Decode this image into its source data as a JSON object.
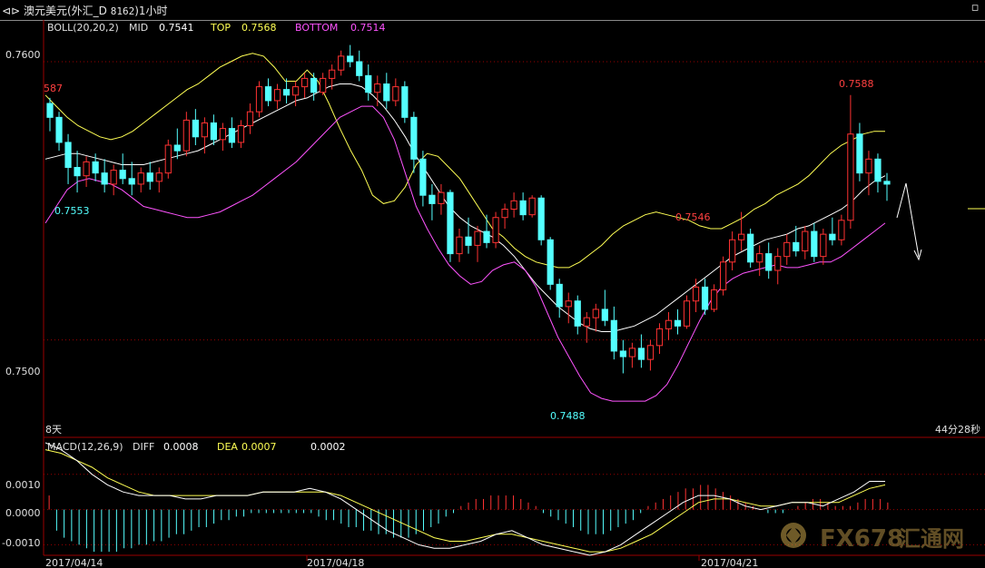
{
  "window": {
    "title": "澳元美元(外汇_D",
    "code": "8162",
    "period": ")1小时"
  },
  "colors": {
    "background": "#000000",
    "up": "#ff3232",
    "down": "#54ffff",
    "mid": "#ffffff",
    "top": "#ffff54",
    "bottom": "#ff54ff",
    "axis": "#9a0000",
    "text": "#e0e0e0"
  },
  "chart_data": [
    {
      "type": "candlestick",
      "indicator": {
        "name": "BOLL(20,20,2)",
        "mid_label": "MID",
        "mid_value": "0.7541",
        "top_label": "TOP",
        "top_value": "0.7568",
        "bottom_label": "BOTTOM",
        "bottom_value": "0.7514"
      },
      "y_ticks": [
        "0.7600",
        "0.7500"
      ],
      "ylim": [
        0.7465,
        0.7615
      ],
      "annotations": {
        "high_left": "587",
        "low_left": "0.7553",
        "high_mid": "0.7546",
        "low_mid": "0.7488",
        "high_right": "0.7588"
      },
      "footer_left": "8天",
      "footer_right": "44分28秒",
      "ohlc": [
        [
          0.7585,
          0.7587,
          0.7575,
          0.758
        ],
        [
          0.758,
          0.7582,
          0.7568,
          0.7571
        ],
        [
          0.7571,
          0.7574,
          0.7556,
          0.7562
        ],
        [
          0.7562,
          0.7568,
          0.7553,
          0.7559
        ],
        [
          0.7559,
          0.7566,
          0.7555,
          0.7564
        ],
        [
          0.7564,
          0.7567,
          0.7557,
          0.756
        ],
        [
          0.756,
          0.7565,
          0.7553,
          0.7556
        ],
        [
          0.7556,
          0.7563,
          0.7552,
          0.7561
        ],
        [
          0.7561,
          0.7567,
          0.7556,
          0.7558
        ],
        [
          0.7558,
          0.7564,
          0.7552,
          0.7556
        ],
        [
          0.7556,
          0.7562,
          0.7553,
          0.756
        ],
        [
          0.756,
          0.7564,
          0.7554,
          0.7557
        ],
        [
          0.7557,
          0.7562,
          0.7553,
          0.756
        ],
        [
          0.756,
          0.7572,
          0.7558,
          0.757
        ],
        [
          0.757,
          0.7576,
          0.7565,
          0.7568
        ],
        [
          0.7568,
          0.7582,
          0.7566,
          0.7579
        ],
        [
          0.7579,
          0.7583,
          0.757,
          0.7573
        ],
        [
          0.7573,
          0.758,
          0.7567,
          0.7578
        ],
        [
          0.7578,
          0.7581,
          0.757,
          0.7572
        ],
        [
          0.7572,
          0.7578,
          0.7568,
          0.7576
        ],
        [
          0.7576,
          0.758,
          0.7569,
          0.7571
        ],
        [
          0.7571,
          0.7579,
          0.7569,
          0.7577
        ],
        [
          0.7577,
          0.7585,
          0.7574,
          0.7582
        ],
        [
          0.7582,
          0.7593,
          0.758,
          0.7591
        ],
        [
          0.7591,
          0.7594,
          0.7584,
          0.7586
        ],
        [
          0.7586,
          0.7592,
          0.7583,
          0.759
        ],
        [
          0.759,
          0.7594,
          0.7585,
          0.7588
        ],
        [
          0.7588,
          0.7593,
          0.7584,
          0.7591
        ],
        [
          0.7591,
          0.7596,
          0.7587,
          0.7594
        ],
        [
          0.7594,
          0.7596,
          0.7586,
          0.7589
        ],
        [
          0.7589,
          0.7596,
          0.7588,
          0.7594
        ],
        [
          0.7594,
          0.7599,
          0.759,
          0.7597
        ],
        [
          0.7597,
          0.7604,
          0.7595,
          0.7602
        ],
        [
          0.7602,
          0.7606,
          0.7598,
          0.76
        ],
        [
          0.76,
          0.7604,
          0.7593,
          0.7595
        ],
        [
          0.7595,
          0.7599,
          0.7586,
          0.7589
        ],
        [
          0.7589,
          0.7595,
          0.7584,
          0.7592
        ],
        [
          0.7592,
          0.7596,
          0.7583,
          0.7586
        ],
        [
          0.7586,
          0.7594,
          0.7584,
          0.7591
        ],
        [
          0.7591,
          0.7593,
          0.7578,
          0.758
        ],
        [
          0.758,
          0.7582,
          0.756,
          0.7565
        ],
        [
          0.7565,
          0.7568,
          0.7548,
          0.7552
        ],
        [
          0.7552,
          0.7556,
          0.7543,
          0.7549
        ],
        [
          0.7549,
          0.7556,
          0.7545,
          0.7553
        ],
        [
          0.7553,
          0.7554,
          0.7528,
          0.7531
        ],
        [
          0.7531,
          0.754,
          0.7528,
          0.7537
        ],
        [
          0.7537,
          0.7544,
          0.7531,
          0.7534
        ],
        [
          0.7534,
          0.7541,
          0.7528,
          0.7539
        ],
        [
          0.7539,
          0.7545,
          0.7533,
          0.7535
        ],
        [
          0.7535,
          0.7546,
          0.7533,
          0.7544
        ],
        [
          0.7544,
          0.7549,
          0.754,
          0.7547
        ],
        [
          0.7547,
          0.7553,
          0.7544,
          0.755
        ],
        [
          0.755,
          0.7553,
          0.7543,
          0.7545
        ],
        [
          0.7545,
          0.7552,
          0.7544,
          0.7551
        ],
        [
          0.7551,
          0.7552,
          0.7534,
          0.7536
        ],
        [
          0.7536,
          0.7537,
          0.7518,
          0.752
        ],
        [
          0.752,
          0.7522,
          0.7508,
          0.7512
        ],
        [
          0.7512,
          0.7517,
          0.7506,
          0.7514
        ],
        [
          0.7514,
          0.7516,
          0.7502,
          0.7505
        ],
        [
          0.7505,
          0.751,
          0.7499,
          0.7508
        ],
        [
          0.7508,
          0.7513,
          0.7503,
          0.7511
        ],
        [
          0.7511,
          0.7518,
          0.7505,
          0.7507
        ],
        [
          0.7507,
          0.7512,
          0.7493,
          0.7496
        ],
        [
          0.7496,
          0.75,
          0.7488,
          0.7494
        ],
        [
          0.7494,
          0.7499,
          0.749,
          0.7497
        ],
        [
          0.7497,
          0.7502,
          0.749,
          0.7493
        ],
        [
          0.7493,
          0.75,
          0.7489,
          0.7498
        ],
        [
          0.7498,
          0.7506,
          0.7495,
          0.7504
        ],
        [
          0.7504,
          0.751,
          0.75,
          0.7507
        ],
        [
          0.7507,
          0.7511,
          0.7502,
          0.7505
        ],
        [
          0.7505,
          0.7516,
          0.7504,
          0.7514
        ],
        [
          0.7514,
          0.7522,
          0.751,
          0.7519
        ],
        [
          0.7519,
          0.7522,
          0.7509,
          0.7511
        ],
        [
          0.7511,
          0.752,
          0.751,
          0.7518
        ],
        [
          0.7518,
          0.753,
          0.7516,
          0.7528
        ],
        [
          0.7528,
          0.7539,
          0.7525,
          0.7536
        ],
        [
          0.7536,
          0.7546,
          0.7532,
          0.7538
        ],
        [
          0.7538,
          0.754,
          0.7526,
          0.7528
        ],
        [
          0.7528,
          0.7534,
          0.7523,
          0.7531
        ],
        [
          0.7531,
          0.7535,
          0.7522,
          0.7525
        ],
        [
          0.7525,
          0.7533,
          0.752,
          0.753
        ],
        [
          0.753,
          0.7538,
          0.7527,
          0.7535
        ],
        [
          0.7535,
          0.7541,
          0.753,
          0.7532
        ],
        [
          0.7532,
          0.7541,
          0.7529,
          0.7539
        ],
        [
          0.7539,
          0.7542,
          0.7528,
          0.753
        ],
        [
          0.753,
          0.754,
          0.7527,
          0.7538
        ],
        [
          0.7538,
          0.7544,
          0.7534,
          0.7536
        ],
        [
          0.7536,
          0.7545,
          0.7534,
          0.7543
        ],
        [
          0.7543,
          0.7588,
          0.754,
          0.7574
        ],
        [
          0.7574,
          0.7578,
          0.7557,
          0.756
        ],
        [
          0.756,
          0.7568,
          0.7552,
          0.7565
        ],
        [
          0.7565,
          0.7567,
          0.7553,
          0.7557
        ],
        [
          0.7557,
          0.756,
          0.755,
          0.7556
        ]
      ],
      "boll_mid": [
        0.7565,
        0.7566,
        0.7567,
        0.7567,
        0.7566,
        0.7565,
        0.7564,
        0.7563,
        0.7563,
        0.7563,
        0.7564,
        0.7565,
        0.7566,
        0.7567,
        0.7568,
        0.757,
        0.7572,
        0.7574,
        0.7576,
        0.7578,
        0.758,
        0.7582,
        0.7584,
        0.7586,
        0.7587,
        0.7589,
        0.7591,
        0.7592,
        0.7592,
        0.7591,
        0.7588,
        0.7584,
        0.7579,
        0.7573,
        0.7566,
        0.756,
        0.7554,
        0.7548,
        0.7544,
        0.7541,
        0.7539,
        0.7537,
        0.7534,
        0.753,
        0.7525,
        0.752,
        0.7516,
        0.7512,
        0.7509,
        0.7506,
        0.7504,
        0.7503,
        0.7503,
        0.7504,
        0.7505,
        0.7507,
        0.7509,
        0.7512,
        0.7515,
        0.7518,
        0.7521,
        0.7524,
        0.7527,
        0.753,
        0.7532,
        0.7534,
        0.7536,
        0.7537,
        0.7538,
        0.754,
        0.7541,
        0.7543,
        0.7545,
        0.7547,
        0.755,
        0.7554,
        0.7557,
        0.7559
      ],
      "boll_top": [
        0.7588,
        0.7584,
        0.758,
        0.7577,
        0.7575,
        0.7573,
        0.7572,
        0.7573,
        0.7575,
        0.7578,
        0.7581,
        0.7584,
        0.7587,
        0.759,
        0.7592,
        0.7595,
        0.7598,
        0.76,
        0.7602,
        0.7603,
        0.7602,
        0.7598,
        0.7593,
        0.7593,
        0.7597,
        0.7593,
        0.7585,
        0.7576,
        0.7568,
        0.7561,
        0.7552,
        0.7549,
        0.755,
        0.7555,
        0.7563,
        0.7567,
        0.7566,
        0.7562,
        0.7558,
        0.7552,
        0.7546,
        0.754,
        0.7537,
        0.7533,
        0.753,
        0.7528,
        0.7527,
        0.7526,
        0.7526,
        0.7528,
        0.7531,
        0.7534,
        0.7538,
        0.7541,
        0.7543,
        0.7545,
        0.7546,
        0.7545,
        0.7544,
        0.7543,
        0.7541,
        0.754,
        0.754,
        0.7542,
        0.7544,
        0.7547,
        0.7549,
        0.7552,
        0.7554,
        0.7556,
        0.7559,
        0.7563,
        0.7567,
        0.757,
        0.7572,
        0.7574,
        0.7575,
        0.7575
      ],
      "boll_bottom": [
        0.7542,
        0.7548,
        0.7554,
        0.7557,
        0.7558,
        0.7557,
        0.7556,
        0.7554,
        0.7551,
        0.7548,
        0.7547,
        0.7546,
        0.7545,
        0.7544,
        0.7544,
        0.7545,
        0.7546,
        0.7548,
        0.755,
        0.7552,
        0.7555,
        0.7558,
        0.7561,
        0.7564,
        0.7568,
        0.7572,
        0.7576,
        0.758,
        0.7582,
        0.7584,
        0.7584,
        0.758,
        0.7572,
        0.756,
        0.7548,
        0.754,
        0.7533,
        0.7527,
        0.7523,
        0.752,
        0.7521,
        0.7525,
        0.7527,
        0.7528,
        0.7525,
        0.7519,
        0.751,
        0.7501,
        0.7494,
        0.7487,
        0.7481,
        0.7479,
        0.7478,
        0.7478,
        0.7478,
        0.7478,
        0.748,
        0.7484,
        0.7491,
        0.7499,
        0.7507,
        0.7514,
        0.7519,
        0.7522,
        0.7524,
        0.7525,
        0.7526,
        0.7527,
        0.7526,
        0.7526,
        0.7527,
        0.7528,
        0.7528,
        0.753,
        0.7533,
        0.7536,
        0.7539,
        0.7542
      ]
    },
    {
      "type": "macd",
      "label": "MACD(12,26,9)",
      "diff_label": "DIFF",
      "diff_value": "0.0008",
      "dea_label": "DEA",
      "dea_value": "0.0007",
      "macd_value": "0.0002",
      "y_ticks": [
        "0.0010",
        "0.0000",
        "-0.0010"
      ],
      "ylim": [
        -0.0013,
        0.002
      ],
      "diff": [
        0.0019,
        0.0017,
        0.0014,
        0.001,
        0.0007,
        0.0005,
        0.0004,
        0.0004,
        0.0004,
        0.0003,
        0.0003,
        0.0004,
        0.0004,
        0.0004,
        0.0005,
        0.0005,
        0.0005,
        0.0006,
        0.0005,
        0.0003,
        0.0,
        -0.0003,
        -0.0006,
        -0.0008,
        -0.001,
        -0.0011,
        -0.0011,
        -0.001,
        -0.0009,
        -0.0007,
        -0.0006,
        -0.0008,
        -0.001,
        -0.0011,
        -0.0012,
        -0.0013,
        -0.0012,
        -0.001,
        -0.0007,
        -0.0004,
        -0.0001,
        0.0002,
        0.0004,
        0.0004,
        0.0003,
        0.0001,
        0.0,
        0.0001,
        0.0002,
        0.0002,
        0.0001,
        0.0003,
        0.0005,
        0.0008,
        0.0008
      ],
      "dea": [
        0.0017,
        0.0016,
        0.0014,
        0.0012,
        0.0009,
        0.0007,
        0.0005,
        0.0004,
        0.0004,
        0.0004,
        0.0004,
        0.0004,
        0.0004,
        0.0004,
        0.0005,
        0.0005,
        0.0005,
        0.0005,
        0.0005,
        0.0004,
        0.0002,
        0.0,
        -0.0002,
        -0.0004,
        -0.0006,
        -0.0008,
        -0.0009,
        -0.0009,
        -0.0008,
        -0.0007,
        -0.0007,
        -0.0008,
        -0.0009,
        -0.001,
        -0.0011,
        -0.0012,
        -0.0012,
        -0.0011,
        -0.0009,
        -0.0007,
        -0.0004,
        -0.0001,
        0.0002,
        0.0003,
        0.0003,
        0.0002,
        0.0001,
        0.0001,
        0.0002,
        0.0002,
        0.0002,
        0.0002,
        0.0004,
        0.0006,
        0.0007
      ],
      "hist": [
        0.0004,
        -0.0006,
        -0.0008,
        -0.0009,
        -0.001,
        -0.0011,
        -0.0012,
        -0.0012,
        -0.0012,
        -0.0012,
        -0.0011,
        -0.0011,
        -0.001,
        -0.001,
        -0.0009,
        -0.0009,
        -0.0008,
        -0.0007,
        -0.0007,
        -0.0006,
        -0.0005,
        -0.0005,
        -0.0004,
        -0.0003,
        -0.0003,
        -0.0002,
        -0.0002,
        -0.0001,
        -0.0001,
        -0.0001,
        -0.0001,
        -0.0001,
        -0.0001,
        -0.0001,
        -0.0001,
        -0.0001,
        -0.0002,
        -0.0003,
        -0.0003,
        -0.0004,
        -0.0005,
        -0.0005,
        -0.0006,
        -0.0006,
        -0.0007,
        -0.0007,
        -0.0008,
        -0.0008,
        -0.0008,
        -0.0007,
        -0.0006,
        -0.0005,
        -0.0004,
        -0.0002,
        -0.0001,
        0.0001,
        0.0002,
        0.0003,
        0.0003,
        0.0004,
        0.0004,
        0.0004,
        0.0004,
        0.0003,
        0.0002,
        0.0001,
        -0.0001,
        -0.0002,
        -0.0003,
        -0.0004,
        -0.0005,
        -0.0006,
        -0.0007,
        -0.0007,
        -0.0007,
        -0.0006,
        -0.0005,
        -0.0004,
        -0.0003,
        -0.0001,
        0.0001,
        0.0002,
        0.0003,
        0.0004,
        0.0005,
        0.0006,
        0.0006,
        0.0007,
        0.0007,
        0.0006,
        0.0005,
        0.0004,
        0.0003,
        0.0002,
        0.0001,
        0.0,
        -0.0001,
        -0.0001,
        -0.0001,
        0.0,
        0.0001,
        0.0002,
        0.0003,
        0.0003,
        0.0002,
        0.0001,
        0.0001,
        0.0001,
        0.0002,
        0.0003,
        0.0003,
        0.0003,
        0.0002
      ]
    }
  ],
  "x_axis": {
    "dates": [
      "2017/04/14",
      "2017/04/18",
      "2017/04/21"
    ]
  },
  "watermark": {
    "brand": "FX678",
    "cn": "汇通网"
  }
}
